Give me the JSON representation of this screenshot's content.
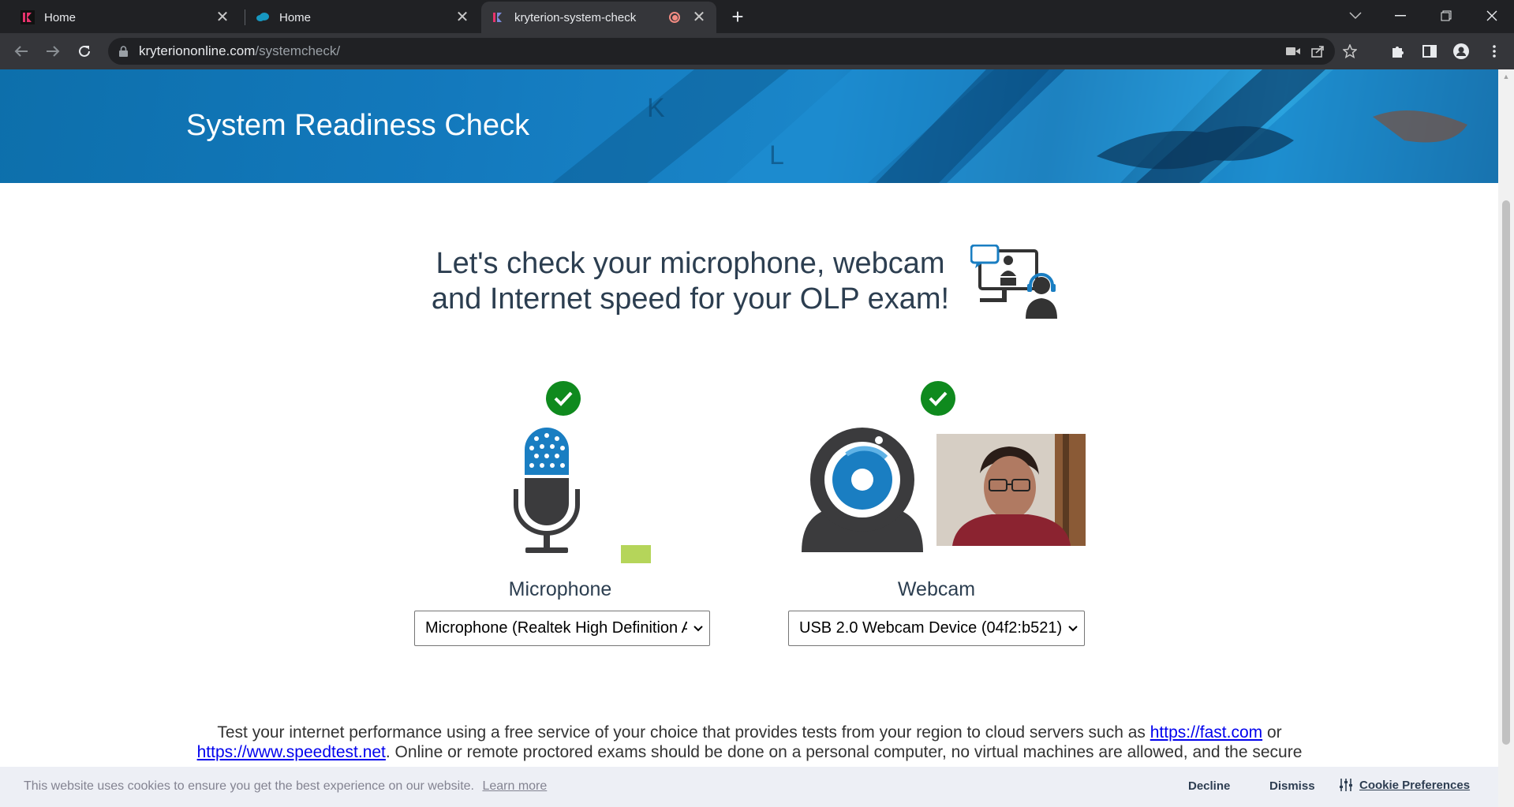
{
  "browser": {
    "tabs": [
      {
        "title": "Home",
        "icon": "kryterion-favicon",
        "active": false
      },
      {
        "title": "Home",
        "icon": "salesforce-cloud-favicon",
        "active": false
      },
      {
        "title": "kryterion-system-check",
        "icon": "kryterion-favicon",
        "active": true,
        "recording": true
      }
    ],
    "close_glyph": "✕",
    "new_tab_glyph": "+",
    "url": {
      "domain": "kryteriononline.com",
      "path": "/systemcheck/"
    },
    "accent": "#202124"
  },
  "page": {
    "hero_title": "System Readiness Check",
    "headline_line1": "Let's check your microphone, webcam",
    "headline_line2": "and Internet speed for your OLP exam!",
    "microphone": {
      "label": "Microphone",
      "selected": "Microphone (Realtek High Definition Audio)",
      "status": "ok",
      "level_color": "#b5d55a"
    },
    "webcam": {
      "label": "Webcam",
      "selected": "USB 2.0 Webcam Device (04f2:b521)",
      "status": "ok"
    },
    "para_part1": "Test your internet performance using a free service of your choice that provides tests from your region to cloud servers such as ",
    "link_fast": "https://fast.com",
    "para_or": " or",
    "link_speedtest": "https://www.speedtest.net",
    "para_part2": ". Online or remote proctored exams should be done on a personal computer, no virtual machines are allowed, and the secure",
    "check_color": "#0f8a1e"
  },
  "cookie_banner": {
    "message": "This website uses cookies to ensure you get the best experience on our website.",
    "learn_more": "Learn more",
    "decline": "Decline",
    "dismiss": "Dismiss",
    "preferences": "Cookie Preferences"
  }
}
